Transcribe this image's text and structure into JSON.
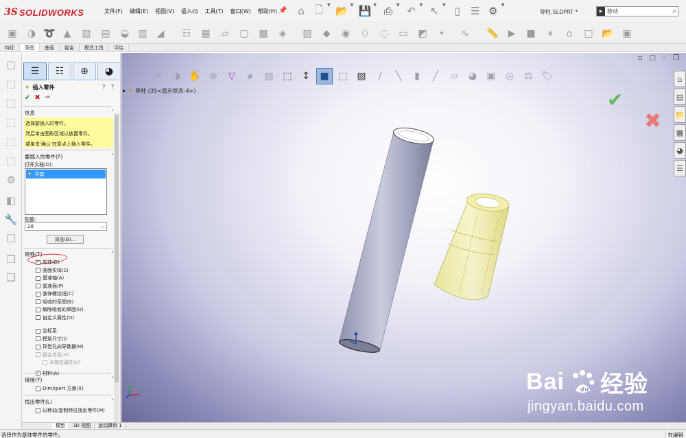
{
  "app": {
    "brand_ds": "3S",
    "brand_name": "SOLIDWORKS",
    "document_title": "导柱.SLDPRT *"
  },
  "menus": [
    "文件(F)",
    "编辑(E)",
    "视图(V)",
    "插入(I)",
    "工具(T)",
    "窗口(W)",
    "帮助(H)"
  ],
  "search": {
    "value": "移动"
  },
  "tabs": [
    {
      "label": "特征",
      "active": false
    },
    {
      "label": "草图",
      "active": true
    },
    {
      "label": "曲面",
      "active": false
    },
    {
      "label": "钣金",
      "active": false
    },
    {
      "label": "模具工具",
      "active": false
    },
    {
      "label": "评估",
      "active": false
    }
  ],
  "panel": {
    "title": "插入零件",
    "help": "? ?",
    "info": {
      "header": "信息",
      "lines": [
        "选择要插入的零件。",
        "然后单击图形区域以放置零件。",
        "或单击'确认'在原点上插入零件。"
      ]
    },
    "part_section": {
      "header": "要插入的零件(P)",
      "open_docs_label": "打开文档(D):",
      "selected_doc": "导套"
    },
    "config": {
      "label": "配置:",
      "value": "28"
    },
    "browse_label": "浏览(B)...",
    "transfer": {
      "header": "转移(T)",
      "items": [
        {
          "label": "实体(D)",
          "checked": true,
          "disabled": false
        },
        {
          "label": "曲面实体(S)",
          "checked": false,
          "disabled": false
        },
        {
          "label": "基准轴(A)",
          "checked": false,
          "disabled": false
        },
        {
          "label": "基准面(P)",
          "checked": false,
          "disabled": false
        },
        {
          "label": "装饰螺纹线(C)",
          "checked": false,
          "disabled": false
        },
        {
          "label": "吸收的草图(B)",
          "checked": false,
          "disabled": false
        },
        {
          "label": "解除吸收的草图(U)",
          "checked": false,
          "disabled": false
        },
        {
          "label": "自定义属性(O)",
          "checked": false,
          "disabled": false
        },
        {
          "label": "坐标系",
          "checked": false,
          "disabled": false
        },
        {
          "label": "模型尺寸(I)",
          "checked": false,
          "disabled": false
        },
        {
          "label": "异型孔向导数据(H)",
          "checked": false,
          "disabled": false
        },
        {
          "label": "钣金信息(H)",
          "checked": false,
          "disabled": true
        },
        {
          "label": "未锁定属性(U)",
          "checked": false,
          "disabled": true,
          "indent": true
        },
        {
          "label": "材料(A)",
          "checked": true,
          "disabled": false
        }
      ]
    },
    "link": {
      "header": "链接(Y)",
      "item": "DimXpert 方案(X)"
    },
    "find": {
      "header": "找出零件(L)",
      "item": "以移动/复制特征找处零件(M)"
    }
  },
  "bottom_tabs": [
    {
      "label": "模型",
      "active": true
    },
    {
      "label": "3D 视图",
      "active": false
    },
    {
      "label": "运动算例 1",
      "active": false
    }
  ],
  "viewport": {
    "tree_root": "导柱  (35<显示状态-4>)"
  },
  "status": {
    "left": "选择作为基体零件的零件。",
    "right": "在编辑"
  },
  "watermark": {
    "line1": "Bai",
    "line1b": "经验",
    "line2": "jingyan.baidu.com"
  },
  "colors": {
    "accent_red": "#d0202a",
    "ok_green": "#59bb5e",
    "info_yellow": "#fffb9c",
    "selection_blue": "#3399ff"
  }
}
